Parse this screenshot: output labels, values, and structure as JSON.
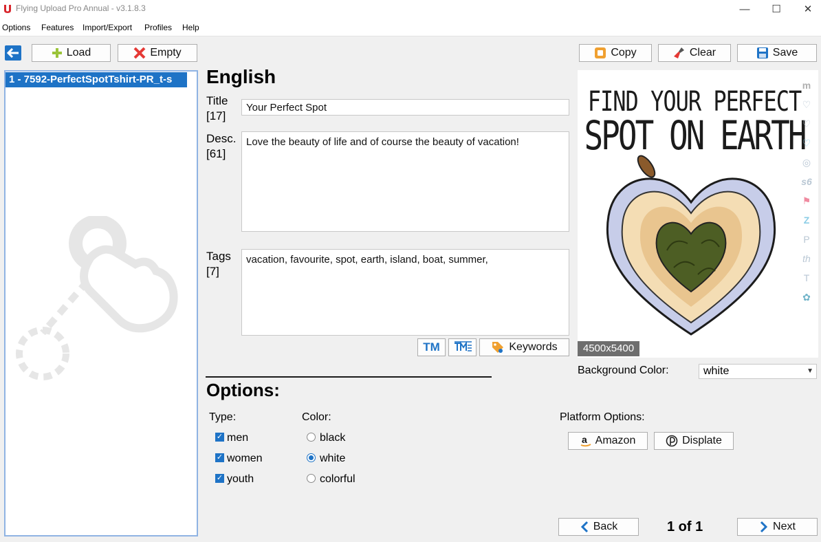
{
  "window": {
    "title": "Flying Upload Pro Annual - v3.1.8.3",
    "controls": [
      "minimize",
      "maximize",
      "close"
    ]
  },
  "menu": [
    "Options",
    "Features",
    "Import/Export",
    "Profiles",
    "Help"
  ],
  "toolbar": {
    "load_label": "Load",
    "empty_label": "Empty",
    "copy_label": "Copy",
    "clear_label": "Clear",
    "save_label": "Save"
  },
  "file_list": {
    "items": [
      "1 - 7592-PerfectSpotTshirt-PR_t-s"
    ],
    "selected_index": 0
  },
  "editor": {
    "language": "English",
    "title_label": "Title",
    "title_count": "[17]",
    "title_value": "Your Perfect Spot",
    "desc_label": "Desc.",
    "desc_count": "[61]",
    "desc_value": "Love the beauty of life and of course the beauty of vacation!",
    "tags_label": "Tags",
    "tags_count": "[7]",
    "tags_value": "vacation, favourite, spot, earth, island, boat, summer,",
    "tm_label": "TM",
    "keywords_label": "Keywords"
  },
  "preview": {
    "line1": "FIND YOUR PERFECT",
    "line2": "SPOT ON EARTH",
    "dimensions": "4500x5400",
    "side_icons": [
      "m",
      "♡",
      "♡",
      "♡",
      "◎",
      "s6",
      "⚑",
      "Z",
      "P",
      "th",
      "T",
      "✿"
    ]
  },
  "background": {
    "label": "Background Color:",
    "value": "white"
  },
  "options": {
    "heading": "Options:",
    "type_label": "Type:",
    "types": [
      {
        "label": "men",
        "checked": true
      },
      {
        "label": "women",
        "checked": true
      },
      {
        "label": "youth",
        "checked": true
      }
    ],
    "color_label": "Color:",
    "colors": [
      {
        "label": "black",
        "selected": false
      },
      {
        "label": "white",
        "selected": true
      },
      {
        "label": "colorful",
        "selected": false
      }
    ],
    "platform_label": "Platform Options:",
    "amazon_label": "Amazon",
    "displate_label": "Displate"
  },
  "pager": {
    "back_label": "Back",
    "next_label": "Next",
    "position": "1 of 1"
  }
}
